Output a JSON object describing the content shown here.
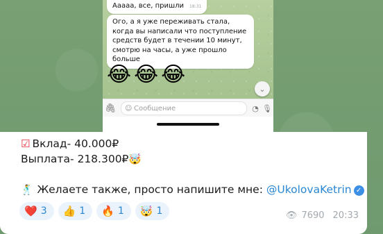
{
  "screenshot": {
    "bubble_top": {
      "text": "Ааааа, все, пришли",
      "time": "18:31"
    },
    "bubble_main": {
      "text": "Ого, а я уже переживать стала, когда вы написали что поступление средств будет в течении 10 минут, смотрю на часы, а уже прошло больше"
    },
    "emojis": [
      "😂",
      "😂",
      "😂"
    ],
    "input_placeholder": "Сообщение"
  },
  "post": {
    "deposit": "Вклад- 40.000₽",
    "payout": "Выплата- 218.300₽",
    "payout_emoji": "🤯",
    "cta": "Желаете также, просто напишите мне:",
    "mention": "@UkolovaKetrin",
    "reactions": [
      {
        "emoji": "❤️",
        "count": "3"
      },
      {
        "emoji": "👍",
        "count": "1"
      },
      {
        "emoji": "🔥",
        "count": "1"
      },
      {
        "emoji": "🤯",
        "count": "1"
      }
    ],
    "views": "7690",
    "time": "20:33"
  },
  "colors": {
    "accent": "#2a86d1",
    "check": "#e5293a",
    "reaction_bg": "#eaf3fb",
    "meta": "#a3a9ae",
    "wallpaper": "#6f9a73"
  },
  "icons": {
    "check": "check-circle-icon",
    "dance": "dancing-figure-icon",
    "verified": "verified-badge-icon",
    "views": "eye-icon",
    "attach": "paperclip-icon",
    "sticker": "sticker-icon",
    "mic": "microphone-icon",
    "scroll": "chevron-down-icon"
  }
}
